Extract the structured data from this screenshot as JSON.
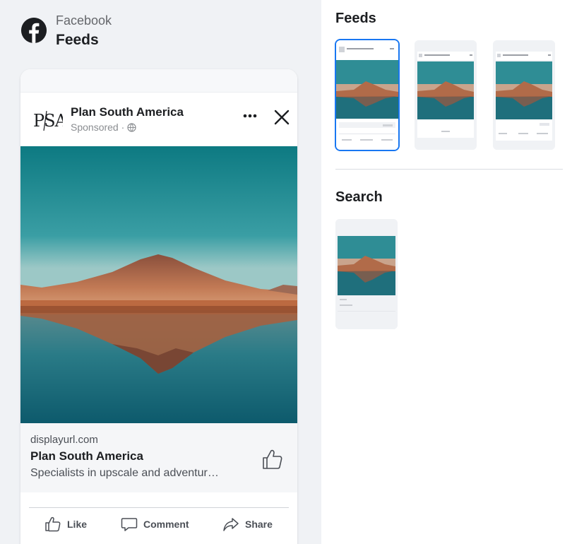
{
  "header": {
    "platform": "Facebook",
    "placement": "Feeds"
  },
  "ad": {
    "brand_logo_text": "PSA",
    "advertiser": "Plan South America",
    "sponsored_label": "Sponsored ·",
    "display_url": "displayurl.com",
    "headline": "Plan South America",
    "description": "Specialists in upscale and adventur…",
    "actions": {
      "like": "Like",
      "comment": "Comment",
      "share": "Share"
    }
  },
  "placements": {
    "feeds_title": "Feeds",
    "search_title": "Search",
    "feeds_thumbnails": [
      {
        "name": "facebook-feed",
        "selected": true
      },
      {
        "name": "feed-variant-2",
        "selected": false
      },
      {
        "name": "feed-variant-3",
        "selected": false
      }
    ],
    "search_thumbnails": [
      {
        "name": "search-results",
        "selected": false
      }
    ]
  },
  "colors": {
    "accent": "#1877f2",
    "sky_top": "#0f7c84",
    "sky_bottom": "#8bbdc0",
    "mountain": "#b86d4b",
    "water": "#1a6a79"
  }
}
